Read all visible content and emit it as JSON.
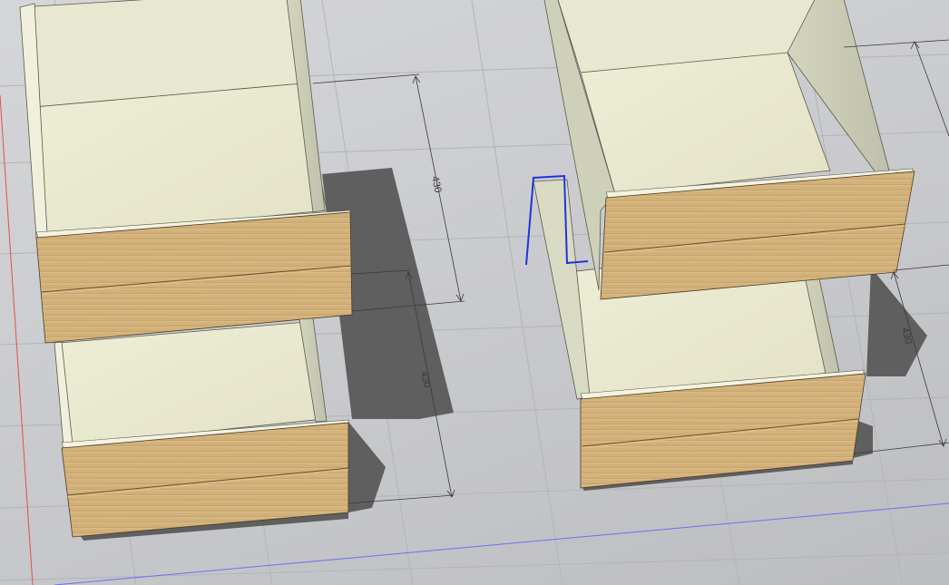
{
  "dimensions": {
    "left_upper": "430",
    "left_lower": "430",
    "right_lower": "430"
  },
  "colors": {
    "grid_line": "#b2b3b6",
    "shadow": "#5e5e5e",
    "panel_light": "#e9e8d2",
    "panel_floor": "#e7e6cc",
    "panel_side_shade": "#c6c7b2",
    "front_wood": "#d5b57f",
    "front_wood_dark": "#bd9b63",
    "selection_blue": "#1f35d6",
    "axis_x_blue": "#5a5cf0",
    "axis_red": "#e05050"
  }
}
